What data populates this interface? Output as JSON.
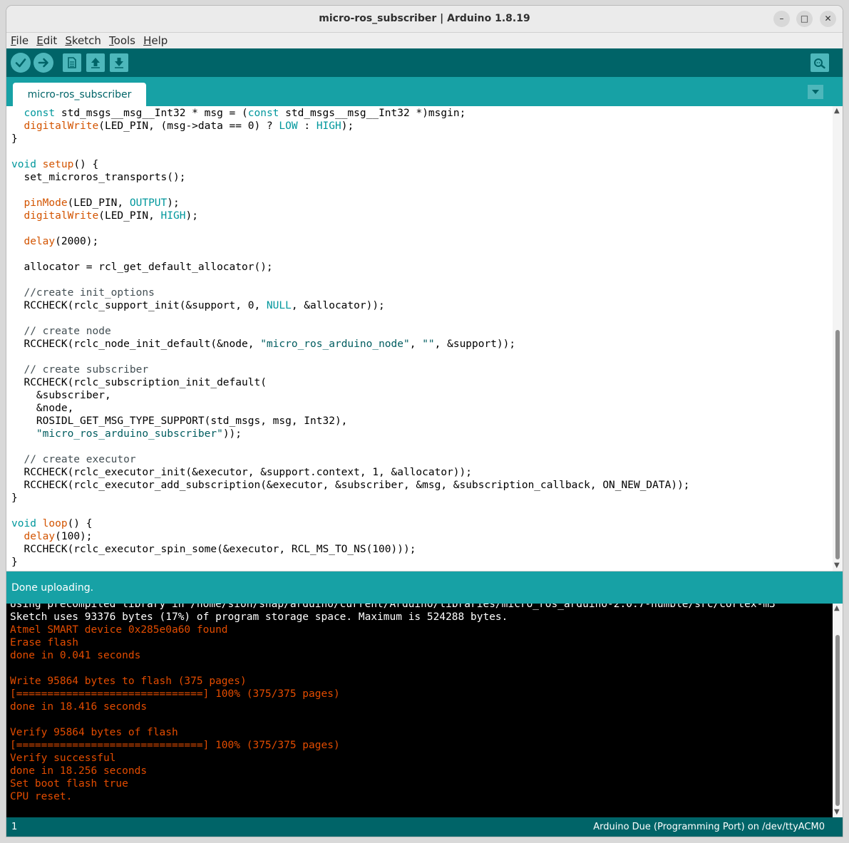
{
  "window": {
    "title": "micro-ros_subscriber | Arduino 1.8.19",
    "controls": {
      "minimize": "–",
      "maximize": "□",
      "close": "✕"
    }
  },
  "menu": {
    "items": [
      {
        "label": "File"
      },
      {
        "label": "Edit"
      },
      {
        "label": "Sketch"
      },
      {
        "label": "Tools"
      },
      {
        "label": "Help"
      }
    ]
  },
  "toolbar": {
    "buttons": [
      "verify-icon",
      "upload-icon",
      "new-icon",
      "open-icon",
      "save-icon"
    ],
    "serial_monitor": "serial-monitor-icon"
  },
  "tabs": {
    "items": [
      {
        "label": "micro-ros_subscriber"
      }
    ]
  },
  "editor": {
    "lines": [
      [
        [
          "  ",
          ""
        ],
        [
          "const",
          "kw"
        ],
        [
          " std_msgs__msg__Int32 * msg = (",
          ""
        ],
        [
          "const",
          "kw"
        ],
        [
          " std_msgs__msg__Int32 *)msgin;",
          ""
        ]
      ],
      [
        [
          "  ",
          ""
        ],
        [
          "digitalWrite",
          "fn"
        ],
        [
          "(LED_PIN, (msg->data == 0) ? ",
          ""
        ],
        [
          "LOW",
          "const"
        ],
        [
          " : ",
          ""
        ],
        [
          "HIGH",
          "const"
        ],
        [
          ");",
          ""
        ]
      ],
      [
        [
          "}",
          ""
        ]
      ],
      [
        [
          "",
          ""
        ]
      ],
      [
        [
          "void",
          "kw"
        ],
        [
          " ",
          ""
        ],
        [
          "setup",
          "fn"
        ],
        [
          "() {",
          ""
        ]
      ],
      [
        [
          "  set_microros_transports();",
          ""
        ]
      ],
      [
        [
          "",
          ""
        ]
      ],
      [
        [
          "  ",
          ""
        ],
        [
          "pinMode",
          "fn"
        ],
        [
          "(LED_PIN, ",
          ""
        ],
        [
          "OUTPUT",
          "const"
        ],
        [
          ");",
          ""
        ]
      ],
      [
        [
          "  ",
          ""
        ],
        [
          "digitalWrite",
          "fn"
        ],
        [
          "(LED_PIN, ",
          ""
        ],
        [
          "HIGH",
          "const"
        ],
        [
          ");",
          ""
        ]
      ],
      [
        [
          "",
          ""
        ]
      ],
      [
        [
          "  ",
          ""
        ],
        [
          "delay",
          "fn"
        ],
        [
          "(2000);",
          ""
        ]
      ],
      [
        [
          "",
          ""
        ]
      ],
      [
        [
          "  allocator = rcl_get_default_allocator();",
          ""
        ]
      ],
      [
        [
          "",
          ""
        ]
      ],
      [
        [
          "  ",
          ""
        ],
        [
          "//create init_options",
          "cm"
        ]
      ],
      [
        [
          "  RCCHECK(rclc_support_init(&support, 0, ",
          ""
        ],
        [
          "NULL",
          "const"
        ],
        [
          ", &allocator));",
          ""
        ]
      ],
      [
        [
          "",
          ""
        ]
      ],
      [
        [
          "  ",
          ""
        ],
        [
          "// create node",
          "cm"
        ]
      ],
      [
        [
          "  RCCHECK(rclc_node_init_default(&node, ",
          ""
        ],
        [
          "\"micro_ros_arduino_node\"",
          "str"
        ],
        [
          ", ",
          ""
        ],
        [
          "\"\"",
          "str"
        ],
        [
          ", &support));",
          ""
        ]
      ],
      [
        [
          "",
          ""
        ]
      ],
      [
        [
          "  ",
          ""
        ],
        [
          "// create subscriber",
          "cm"
        ]
      ],
      [
        [
          "  RCCHECK(rclc_subscription_init_default(",
          ""
        ]
      ],
      [
        [
          "    &subscriber,",
          ""
        ]
      ],
      [
        [
          "    &node,",
          ""
        ]
      ],
      [
        [
          "    ROSIDL_GET_MSG_TYPE_SUPPORT(std_msgs, msg, Int32),",
          ""
        ]
      ],
      [
        [
          "    ",
          ""
        ],
        [
          "\"micro_ros_arduino_subscriber\"",
          "str"
        ],
        [
          "));",
          ""
        ]
      ],
      [
        [
          "",
          ""
        ]
      ],
      [
        [
          "  ",
          ""
        ],
        [
          "// create executor",
          "cm"
        ]
      ],
      [
        [
          "  RCCHECK(rclc_executor_init(&executor, &support.context, 1, &allocator));",
          ""
        ]
      ],
      [
        [
          "  RCCHECK(rclc_executor_add_subscription(&executor, &subscriber, &msg, &subscription_callback, ON_NEW_DATA));",
          ""
        ]
      ],
      [
        [
          "}",
          ""
        ]
      ],
      [
        [
          "",
          ""
        ]
      ],
      [
        [
          "void",
          "kw"
        ],
        [
          " ",
          ""
        ],
        [
          "loop",
          "fn"
        ],
        [
          "() {",
          ""
        ]
      ],
      [
        [
          "  ",
          ""
        ],
        [
          "delay",
          "fn"
        ],
        [
          "(100);",
          ""
        ]
      ],
      [
        [
          "  RCCHECK(rclc_executor_spin_some(&executor, RCL_MS_TO_NS(100)));",
          ""
        ]
      ],
      [
        [
          "}",
          ""
        ]
      ]
    ]
  },
  "status": {
    "message": "Done uploading."
  },
  "console": {
    "lines": [
      {
        "text": "Using precompiled library in /home/sion/snap/arduino/current/Arduino/libraries/micro_ros_arduino-2.0.7-humble/src/cortex-m3",
        "color": "white"
      },
      {
        "text": "Sketch uses 93376 bytes (17%) of program storage space. Maximum is 524288 bytes.",
        "color": "white"
      },
      {
        "text": "Atmel SMART device 0x285e0a60 found",
        "color": "red"
      },
      {
        "text": "Erase flash",
        "color": "red"
      },
      {
        "text": "done in 0.041 seconds",
        "color": "red"
      },
      {
        "text": "",
        "color": "red"
      },
      {
        "text": "Write 95864 bytes to flash (375 pages)",
        "color": "red"
      },
      {
        "text": "[==============================] 100% (375/375 pages)",
        "color": "red"
      },
      {
        "text": "done in 18.416 seconds",
        "color": "red"
      },
      {
        "text": "",
        "color": "red"
      },
      {
        "text": "Verify 95864 bytes of flash",
        "color": "red"
      },
      {
        "text": "[==============================] 100% (375/375 pages)",
        "color": "red"
      },
      {
        "text": "Verify successful",
        "color": "red"
      },
      {
        "text": "done in 18.256 seconds",
        "color": "red"
      },
      {
        "text": "Set boot flash true",
        "color": "red"
      },
      {
        "text": "CPU reset.",
        "color": "red"
      }
    ]
  },
  "bottom": {
    "line_number": "1",
    "board": "Arduino Due (Programming Port) on /dev/ttyACM0"
  },
  "colors": {
    "teal_dark": "#006468",
    "teal": "#17a1a5",
    "button": "#4db7bb",
    "console_red": "#e34c00"
  }
}
